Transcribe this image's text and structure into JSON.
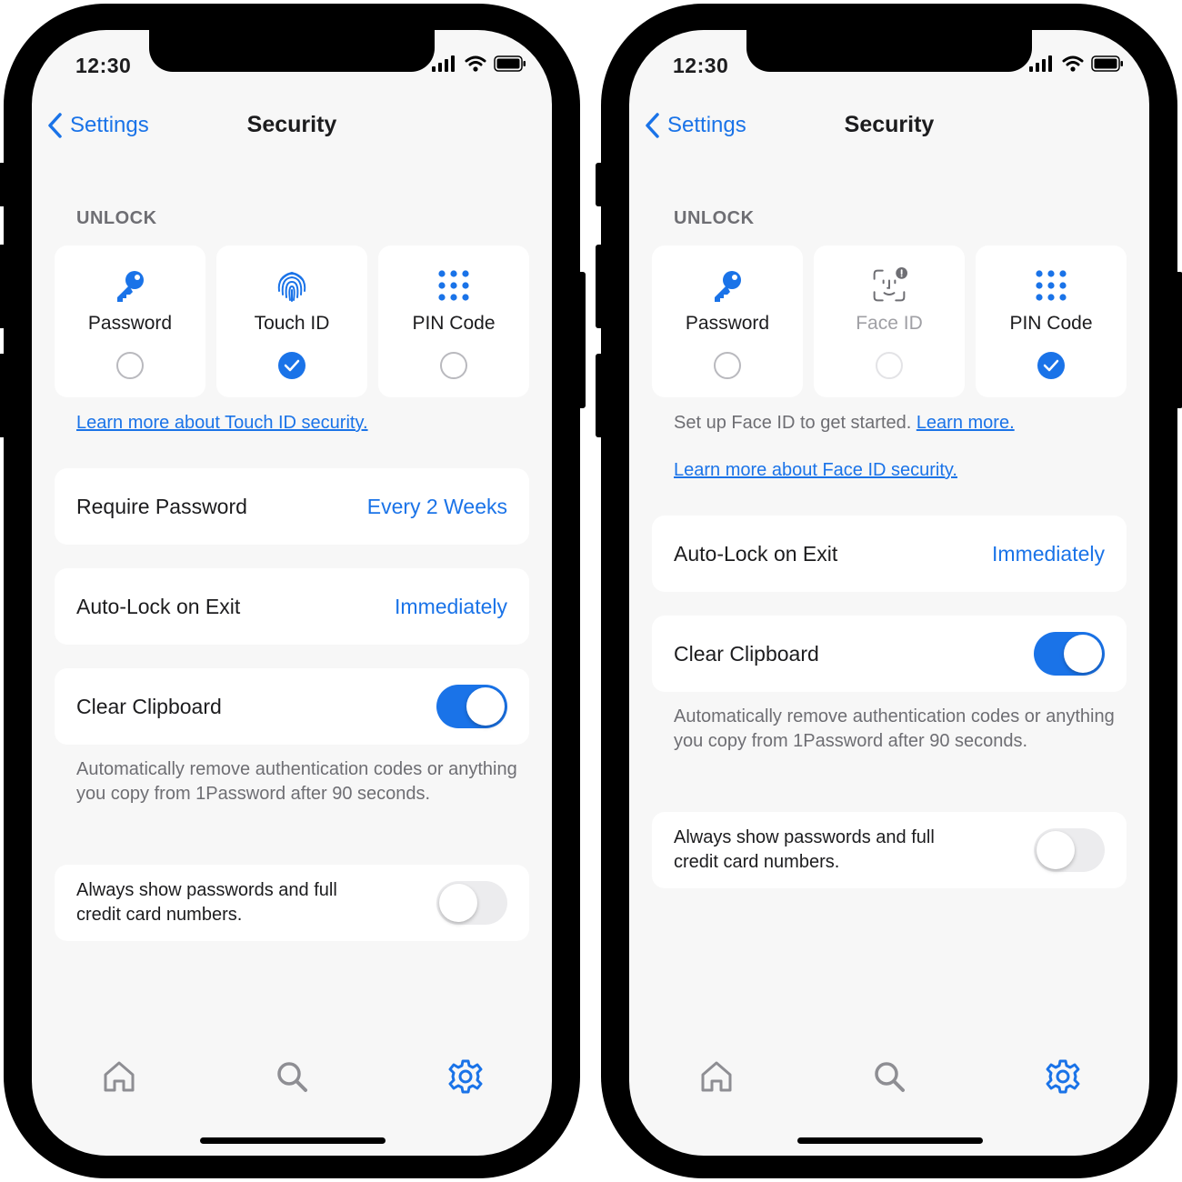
{
  "colors": {
    "accent": "#1a73e8",
    "secondary_text": "#6e6e73",
    "screen_bg": "#f7f7f7",
    "frame": "#000000"
  },
  "phones": [
    {
      "status": {
        "time": "12:30"
      },
      "nav": {
        "back_label": "Settings",
        "title": "Security"
      },
      "unlock": {
        "section_label": "UNLOCK",
        "options": [
          {
            "label": "Password",
            "icon": "key-icon",
            "selected": false
          },
          {
            "label": "Touch ID",
            "icon": "fingerprint-icon",
            "selected": true
          },
          {
            "label": "PIN Code",
            "icon": "keypad-icon",
            "selected": false
          }
        ],
        "learn_link": "Learn more about Touch ID security."
      },
      "rows": {
        "require_password": {
          "label": "Require Password",
          "value": "Every 2 Weeks"
        },
        "auto_lock": {
          "label": "Auto-Lock on Exit",
          "value": "Immediately"
        },
        "clear_clipboard": {
          "label": "Clear Clipboard",
          "enabled": true,
          "description": "Automatically remove authentication codes or anything you copy from 1Password after 90 seconds."
        },
        "always_show": {
          "label": "Always show passwords and full credit card numbers.",
          "enabled": false
        }
      },
      "tabs": [
        "home-icon",
        "search-icon",
        "gear-icon"
      ],
      "active_tab": "gear-icon"
    },
    {
      "status": {
        "time": "12:30"
      },
      "nav": {
        "back_label": "Settings",
        "title": "Security"
      },
      "unlock": {
        "section_label": "UNLOCK",
        "options": [
          {
            "label": "Password",
            "icon": "key-icon",
            "selected": false
          },
          {
            "label": "Face ID",
            "icon": "face-id-icon",
            "selected": false,
            "disabled": true
          },
          {
            "label": "PIN Code",
            "icon": "keypad-icon",
            "selected": true
          }
        ],
        "setup_text": "Set up Face ID to get started.",
        "setup_link": "Learn more.",
        "learn_link": "Learn more about Face ID security."
      },
      "rows": {
        "auto_lock": {
          "label": "Auto-Lock on Exit",
          "value": "Immediately"
        },
        "clear_clipboard": {
          "label": "Clear Clipboard",
          "enabled": true,
          "description": "Automatically remove authentication codes or anything you copy from 1Password after 90 seconds."
        },
        "always_show": {
          "label": "Always show passwords and full credit card numbers.",
          "enabled": false
        }
      },
      "tabs": [
        "home-icon",
        "search-icon",
        "gear-icon"
      ],
      "active_tab": "gear-icon"
    }
  ]
}
